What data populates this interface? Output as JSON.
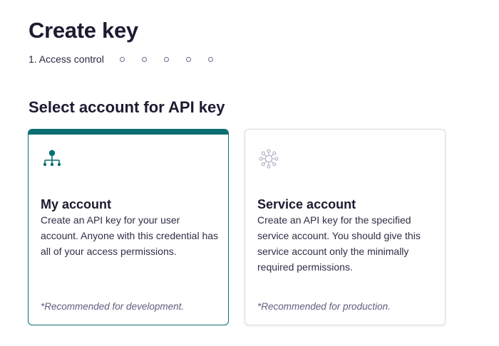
{
  "page": {
    "title": "Create key"
  },
  "stepper": {
    "current_step_label": "1. Access control",
    "remaining_steps": 5
  },
  "section": {
    "title": "Select account for API key"
  },
  "cards": [
    {
      "title": "My account",
      "description": "Create an API key for your user account. Anyone with this credential has all of your access permissions.",
      "note": "*Recommended for development.",
      "icon": "user-hierarchy-icon",
      "selected": true
    },
    {
      "title": "Service account",
      "description": "Create an API key for the specified service account. You should give this service account only the minimally required permissions.",
      "note": "*Recommended for production.",
      "icon": "service-network-icon",
      "selected": false
    }
  ],
  "colors": {
    "accent": "#0a6e70",
    "text": "#1c1b30",
    "muted": "#5f5e80",
    "card_border": "#dcdbe3",
    "step_dot": "#6b6a8e",
    "service_icon": "#b9b8cc"
  }
}
